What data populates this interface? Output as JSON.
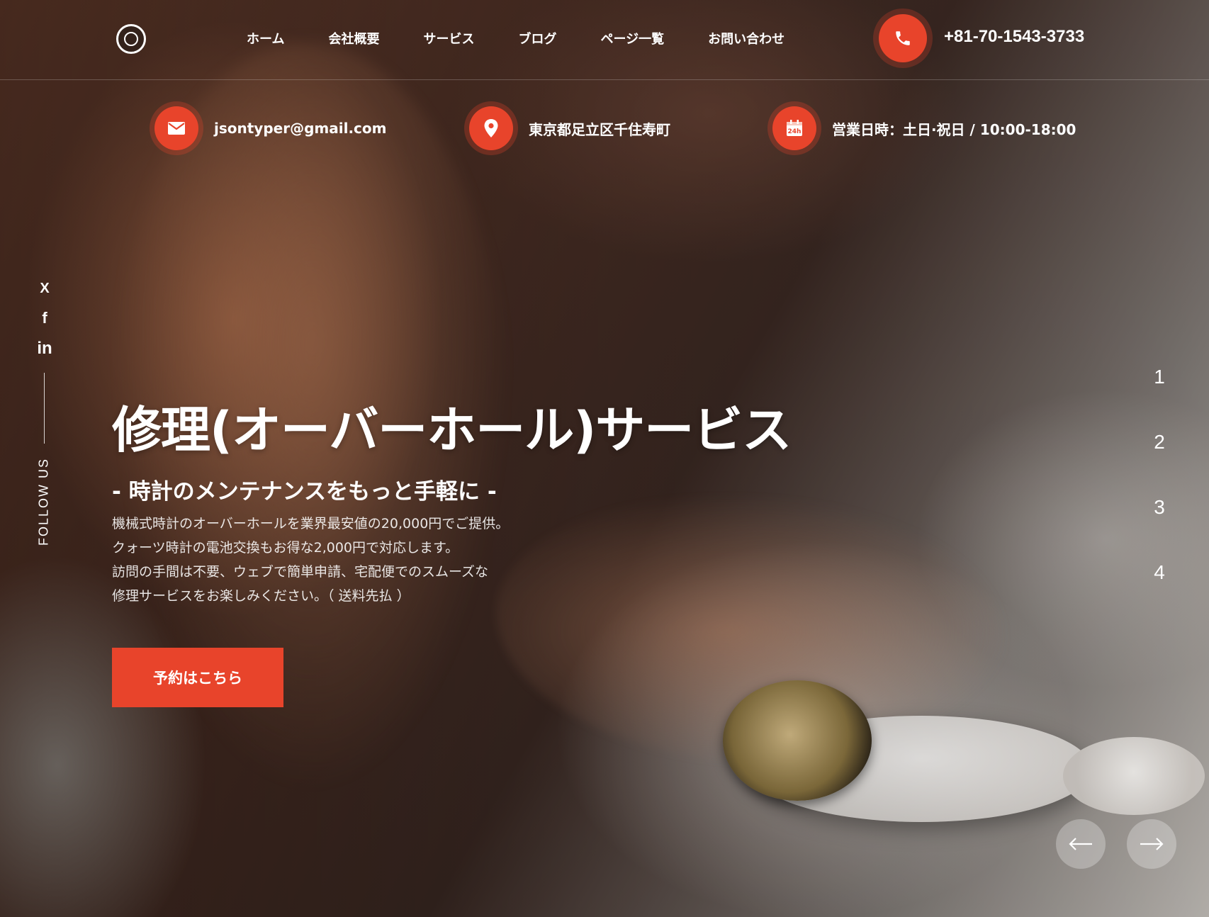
{
  "nav": {
    "items": [
      "ホーム",
      "会社概要",
      "サービス",
      "ブログ",
      "ページ一覧",
      "お問い合わせ"
    ]
  },
  "header": {
    "phone": "+81-70-1543-3733"
  },
  "info": {
    "email": "jsontyper@gmail.com",
    "address": "東京都足立区千住寿町",
    "hours": "営業日時：土日·祝日 / 10:00-18:00",
    "calendar_badge": "24h"
  },
  "social": {
    "label": "FOLLOW US",
    "items": [
      "X",
      "f",
      "in"
    ]
  },
  "hero": {
    "title": "修理(オーバーホール)サービス",
    "subtitle": "- 時計のメンテナンスをもっと手軽に -",
    "desc": [
      "機械式時計のオーバーホールを業界最安値の20,000円でご提供。",
      "クォーツ時計の電池交換もお得な2,000円で対応します。",
      "訪問の手間は不要、ウェブで簡単申請、宅配便でのスムーズな",
      "修理サービスをお楽しみください。（ 送料先払 ）"
    ],
    "cta": "予約はこちら"
  },
  "slider": {
    "numbers": [
      "1",
      "2",
      "3",
      "4"
    ]
  },
  "colors": {
    "accent": "#e8442b"
  }
}
